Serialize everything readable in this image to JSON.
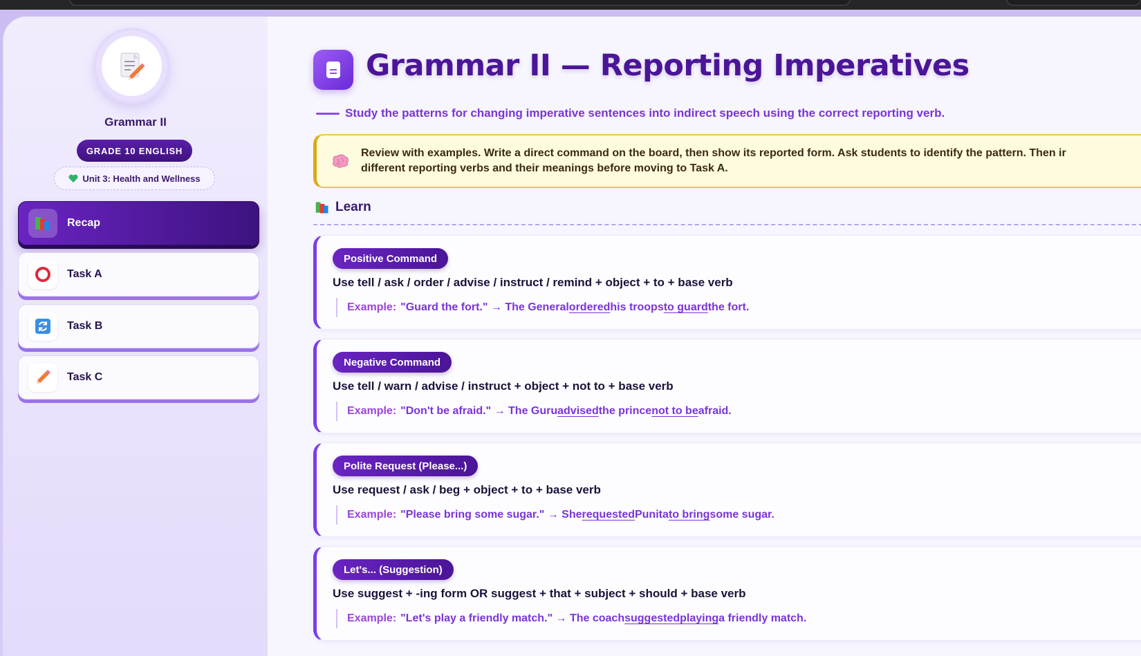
{
  "sidebar": {
    "title": "Grammar II",
    "grade": "GRADE 10 ENGLISH",
    "unit": "Unit 3: Health and Wellness",
    "items": [
      {
        "label": "Recap",
        "icon": "books-icon",
        "active": true
      },
      {
        "label": "Task A",
        "icon": "ring-icon",
        "active": false
      },
      {
        "label": "Task B",
        "icon": "refresh-icon",
        "active": false
      },
      {
        "label": "Task C",
        "icon": "pencil-icon",
        "active": false
      }
    ]
  },
  "main": {
    "title": "Grammar II — Reporting Imperatives",
    "subtitle": "Study the patterns for changing imperative sentences into indirect speech using the correct reporting verb.",
    "tip": {
      "line1": "Review with examples. Write a direct command on the board, then show its reported form. Ask students to identify the pattern. Then ir",
      "line2": "different reporting verbs and their meanings before moving to Task A."
    },
    "section": "Learn",
    "cards": [
      {
        "tag": "Positive Command",
        "rule": "Use tell / ask / order / advise / instruct / remind + object + to + base verb",
        "example_label": "Example:",
        "ex": [
          "\"Guard the fort.\" → The General ",
          "ordered",
          " his troops ",
          "to guard",
          " the fort."
        ]
      },
      {
        "tag": "Negative Command",
        "rule": "Use tell / warn / advise / instruct + object + not to + base verb",
        "example_label": "Example:",
        "ex": [
          "\"Don't be afraid.\" → The Guru ",
          "advised",
          " the prince ",
          "not to be",
          " afraid."
        ]
      },
      {
        "tag": "Polite Request (Please...)",
        "rule": "Use request / ask / beg + object + to + base verb",
        "example_label": "Example:",
        "ex": [
          "\"Please bring some sugar.\" → She ",
          "requested",
          " Punita ",
          "to bring",
          " some sugar."
        ]
      },
      {
        "tag": "Let's... (Suggestion)",
        "rule": "Use suggest + -ing form OR suggest + that + subject + should + base verb",
        "example_label": "Example:",
        "ex": [
          "\"Let's play a friendly match.\" → The coach ",
          "suggested",
          " ",
          "playing",
          " a friendly match."
        ]
      }
    ]
  },
  "colors": {
    "primary": "#4a1597",
    "accent": "#7b3fe0",
    "tip_bg": "#fffbdf",
    "tip_border": "#d8ab1c"
  }
}
